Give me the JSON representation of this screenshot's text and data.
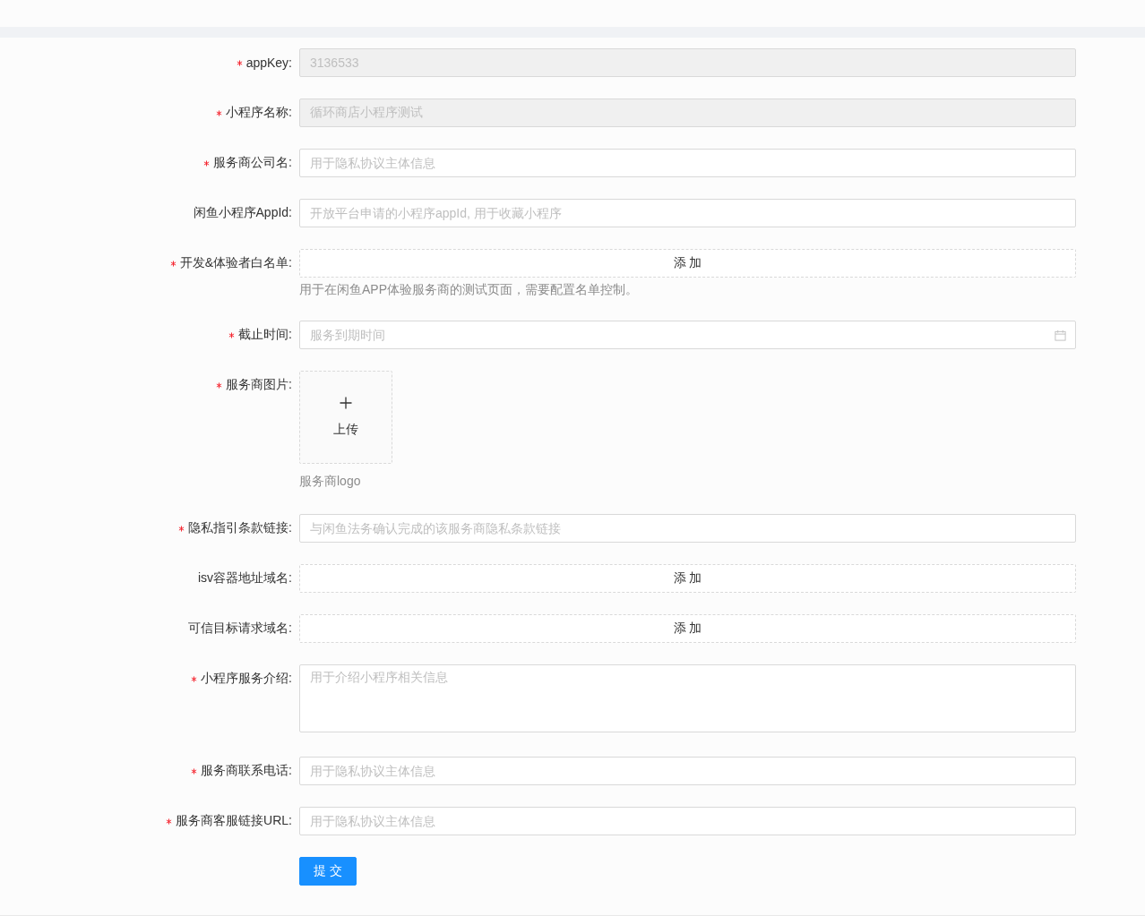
{
  "form": {
    "fields": [
      {
        "kind": "input",
        "label": "appKey:",
        "required": true,
        "disabled": true,
        "value": "3136533"
      },
      {
        "kind": "input",
        "label": "小程序名称:",
        "required": true,
        "disabled": true,
        "value": "循环商店小程序测试"
      },
      {
        "kind": "input",
        "label": "服务商公司名:",
        "required": true,
        "disabled": false,
        "placeholder": "用于隐私协议主体信息"
      },
      {
        "kind": "input",
        "label": "闲鱼小程序AppId:",
        "required": false,
        "disabled": false,
        "placeholder": "开放平台申请的小程序appId, 用于收藏小程序"
      },
      {
        "kind": "add",
        "label": "开发&体验者白名单:",
        "required": true,
        "button": "添 加",
        "help": "用于在闲鱼APP体验服务商的测试页面，需要配置名单控制。"
      },
      {
        "kind": "date",
        "label": "截止时间:",
        "required": true,
        "placeholder": "服务到期时间"
      },
      {
        "kind": "upload",
        "label": "服务商图片:",
        "required": true,
        "button": "上传",
        "help": "服务商logo"
      },
      {
        "kind": "input",
        "label": "隐私指引条款链接:",
        "required": true,
        "disabled": false,
        "placeholder": "与闲鱼法务确认完成的该服务商隐私条款链接"
      },
      {
        "kind": "add",
        "label": "isv容器地址域名:",
        "required": false,
        "button": "添 加"
      },
      {
        "kind": "add",
        "label": "可信目标请求域名:",
        "required": false,
        "button": "添 加"
      },
      {
        "kind": "textarea",
        "label": "小程序服务介绍:",
        "required": true,
        "placeholder": "用于介绍小程序相关信息"
      },
      {
        "kind": "input",
        "label": "服务商联系电话:",
        "required": true,
        "disabled": false,
        "placeholder": "用于隐私协议主体信息"
      },
      {
        "kind": "input",
        "label": "服务商客服链接URL:",
        "required": true,
        "disabled": false,
        "placeholder": "用于隐私协议主体信息"
      }
    ],
    "submit": "提 交"
  }
}
